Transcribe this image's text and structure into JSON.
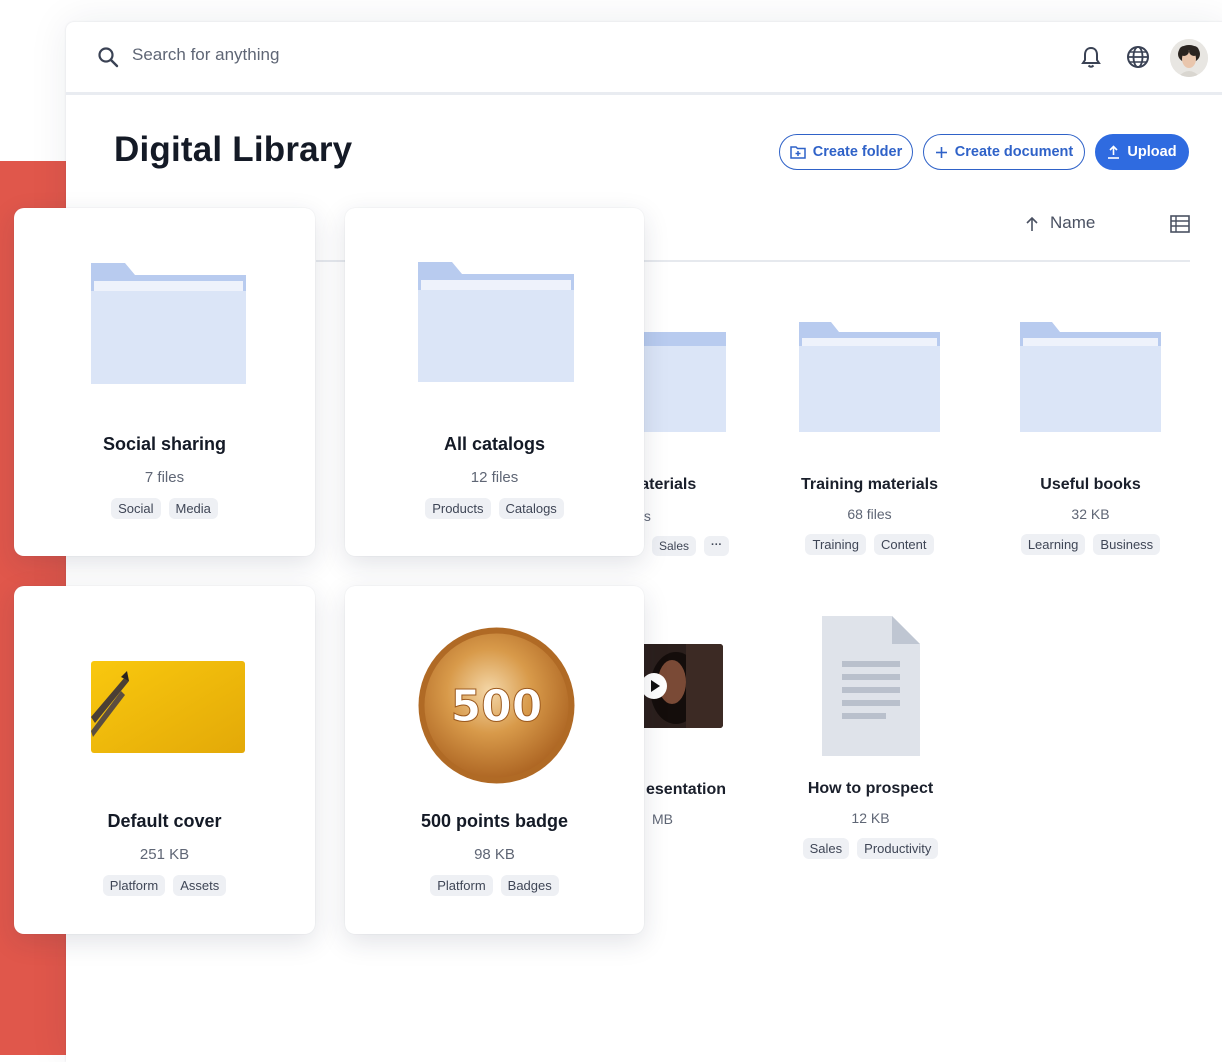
{
  "search": {
    "placeholder": "Search for anything"
  },
  "page": {
    "title": "Digital Library"
  },
  "actions": {
    "create_folder": "Create folder",
    "create_document": "Create document",
    "upload": "Upload"
  },
  "sort": {
    "label": "Name"
  },
  "background_items": [
    {
      "name": "materials",
      "meta": "files",
      "tags": [
        "Sales",
        "···"
      ]
    },
    {
      "name": "Training materials",
      "meta": "68 files",
      "tags": [
        "Training",
        "Content"
      ]
    },
    {
      "name": "Useful books",
      "meta": "32 KB",
      "tags": [
        "Learning",
        "Business"
      ]
    },
    {
      "name": "esentation",
      "meta": "MB",
      "tags": []
    },
    {
      "name": "How to prospect",
      "meta": "12 KB",
      "tags": [
        "Sales",
        "Productivity"
      ]
    }
  ],
  "cards": [
    {
      "name": "Social sharing",
      "meta": "7 files",
      "tags": [
        "Social",
        "Media"
      ]
    },
    {
      "name": "All catalogs",
      "meta": "12 files",
      "tags": [
        "Products",
        "Catalogs"
      ]
    },
    {
      "name": "Default cover",
      "meta": "251 KB",
      "tags": [
        "Platform",
        "Assets"
      ]
    },
    {
      "name": "500 points badge",
      "meta": "98 KB",
      "tags": [
        "Platform",
        "Badges"
      ],
      "badge_text": "500"
    }
  ],
  "colors": {
    "accent": "#2f6be0",
    "side_band": "#e0574b",
    "folder": "#dbe5f7",
    "folder_tab": "#b8cbef"
  }
}
